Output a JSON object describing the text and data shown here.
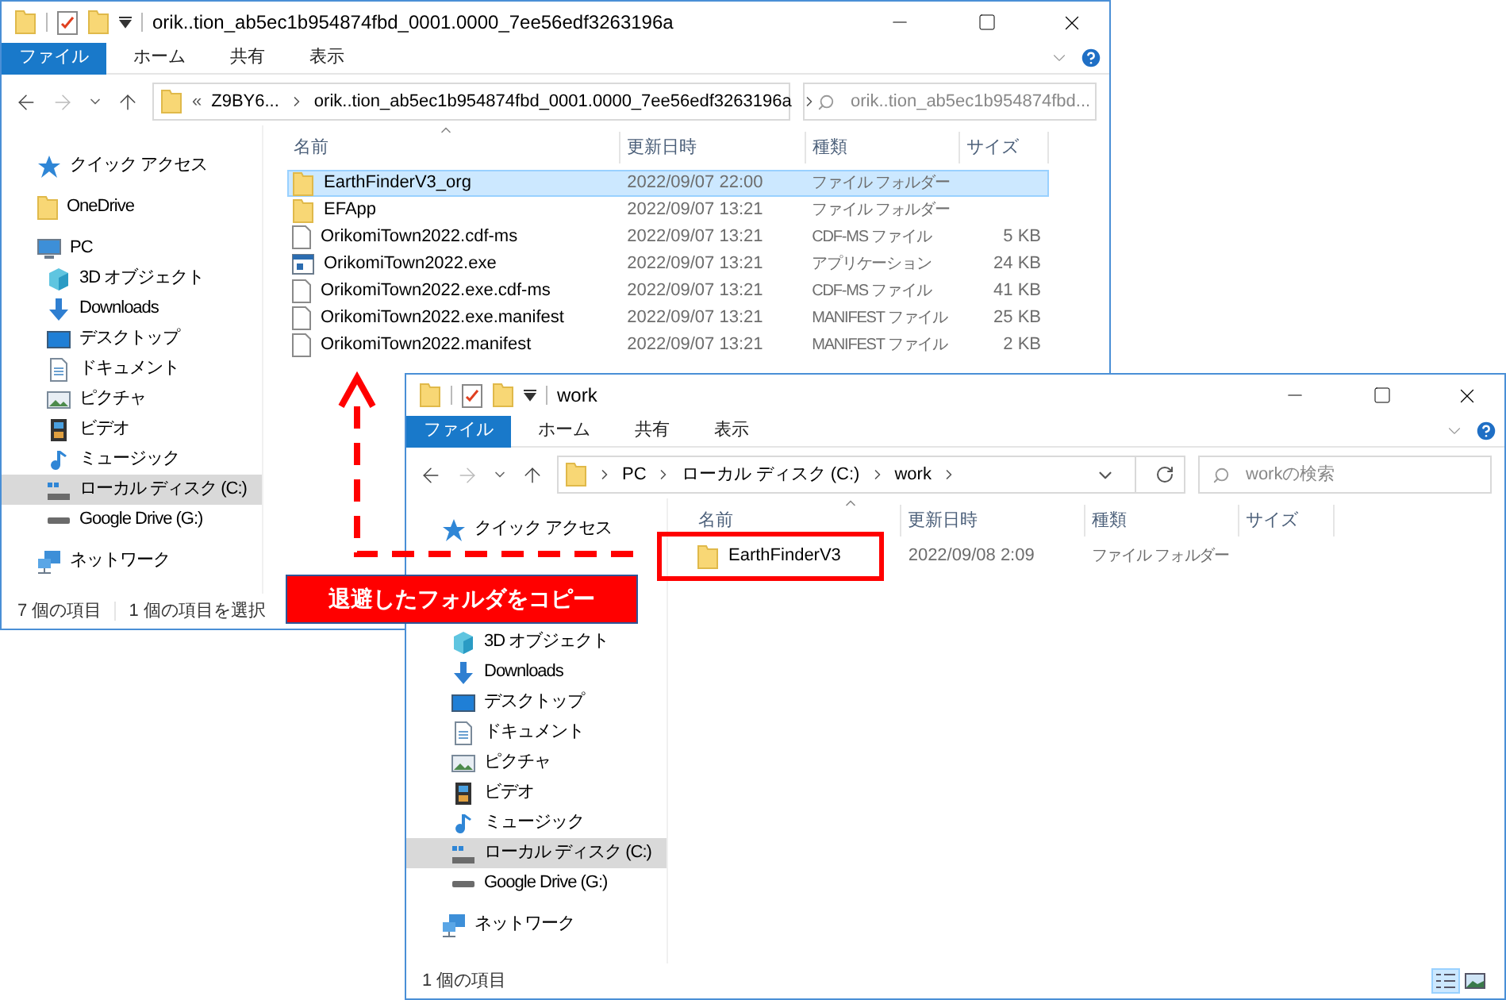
{
  "windows": [
    {
      "title": "orik..tion_ab5ec1b954874fbd_0001.0000_7ee56edf3263196a",
      "ribbon_tabs": [
        {
          "label": "ファイル",
          "selected": true
        },
        {
          "label": "ホーム",
          "selected": false
        },
        {
          "label": "共有",
          "selected": false
        },
        {
          "label": "表示",
          "selected": false
        }
      ],
      "address": {
        "overflow_mark": "«",
        "segments": [
          "Z9BY6...",
          "orik..tion_ab5ec1b954874fbd_0001.0000_7ee56edf3263196a"
        ]
      },
      "search": {
        "placeholder": "orik..tion_ab5ec1b954874fbd..."
      },
      "sidebar": [
        {
          "label": "クイック アクセス",
          "kind": "star",
          "selected": false
        },
        {
          "label": "OneDrive",
          "kind": "folder",
          "selected": false
        },
        {
          "label": "PC",
          "kind": "pc",
          "selected": false,
          "children": [
            {
              "label": "3D オブジェクト",
              "kind": "cube",
              "selected": false
            },
            {
              "label": "Downloads",
              "kind": "download",
              "selected": false
            },
            {
              "label": "デスクトップ",
              "kind": "desktop",
              "selected": false
            },
            {
              "label": "ドキュメント",
              "kind": "document",
              "selected": false
            },
            {
              "label": "ピクチャ",
              "kind": "picture",
              "selected": false
            },
            {
              "label": "ビデオ",
              "kind": "video",
              "selected": false
            },
            {
              "label": "ミュージック",
              "kind": "music",
              "selected": false
            },
            {
              "label": "ローカル ディスク (C:)",
              "kind": "disk",
              "selected": true
            },
            {
              "label": "Google Drive (G:)",
              "kind": "drive",
              "selected": false
            }
          ]
        },
        {
          "label": "ネットワーク",
          "kind": "network",
          "selected": false
        }
      ],
      "columns": [
        "名前",
        "更新日時",
        "種類",
        "サイズ"
      ],
      "rows": [
        {
          "name": "EarthFinderV3_org",
          "date": "2022/09/07 22:00",
          "type": "ファイル フォルダー",
          "kind": "folder",
          "selected": true
        },
        {
          "name": "EFApp",
          "date": "2022/09/07 13:21",
          "type": "ファイル フォルダー",
          "kind": "folder",
          "selected": false
        },
        {
          "name": "OrikomiTown2022.cdf-ms",
          "date": "2022/09/07 13:21",
          "type": "CDF-MS ファイル",
          "size": "5 KB",
          "kind": "file",
          "selected": false
        },
        {
          "name": "OrikomiTown2022.exe",
          "date": "2022/09/07 13:21",
          "type": "アプリケーション",
          "size": "24 KB",
          "kind": "app",
          "selected": false
        },
        {
          "name": "OrikomiTown2022.exe.cdf-ms",
          "date": "2022/09/07 13:21",
          "type": "CDF-MS ファイル",
          "size": "41 KB",
          "kind": "file",
          "selected": false
        },
        {
          "name": "OrikomiTown2022.exe.manifest",
          "date": "2022/09/07 13:21",
          "type": "MANIFEST ファイル",
          "size": "25 KB",
          "kind": "file",
          "selected": false
        },
        {
          "name": "OrikomiTown2022.manifest",
          "date": "2022/09/07 13:21",
          "type": "MANIFEST ファイル",
          "size": "2 KB",
          "kind": "file",
          "selected": false
        }
      ],
      "status": [
        "7 個の項目",
        "1 個の項目を選択"
      ]
    },
    {
      "title": "work",
      "ribbon_tabs": [
        {
          "label": "ファイル",
          "selected": true
        },
        {
          "label": "ホーム",
          "selected": false
        },
        {
          "label": "共有",
          "selected": false
        },
        {
          "label": "表示",
          "selected": false
        }
      ],
      "address": {
        "segments": [
          "PC",
          "ローカル ディスク (C:)",
          "work"
        ]
      },
      "search": {
        "placeholder": "workの検索"
      },
      "sidebar": [
        {
          "label": "クイック アクセス",
          "kind": "star",
          "selected": false
        },
        {
          "selected": false
        },
        {
          "selected": false,
          "children": [
            {
              "label": "3D オブジェクト",
              "kind": "cube",
              "selected": false
            },
            {
              "label": "Downloads",
              "kind": "download",
              "selected": false
            },
            {
              "label": "デスクトップ",
              "kind": "desktop",
              "selected": false
            },
            {
              "label": "ドキュメント",
              "kind": "document",
              "selected": false
            },
            {
              "label": "ピクチャ",
              "kind": "picture",
              "selected": false
            },
            {
              "label": "ビデオ",
              "kind": "video",
              "selected": false
            },
            {
              "label": "ミュージック",
              "kind": "music",
              "selected": false
            },
            {
              "label": "ローカル ディスク (C:)",
              "kind": "disk",
              "selected": true
            },
            {
              "label": "Google Drive (G:)",
              "kind": "drive",
              "selected": false
            }
          ]
        },
        {
          "label": "ネットワーク",
          "kind": "network",
          "selected": false
        }
      ],
      "columns": [
        "名前",
        "更新日時",
        "種類",
        "サイズ"
      ],
      "rows": [
        {
          "name": "EarthFinderV3",
          "date": "2022/09/08 2:09",
          "type": "ファイル フォルダー",
          "kind": "folder",
          "selected": false,
          "highlighted": true
        }
      ],
      "status": [
        "1 個の項目"
      ],
      "view_buttons": [
        {
          "kind": "details",
          "selected": true
        },
        {
          "kind": "large",
          "selected": false
        }
      ]
    }
  ],
  "callout": {
    "text": "退避したフォルダをコピー"
  }
}
